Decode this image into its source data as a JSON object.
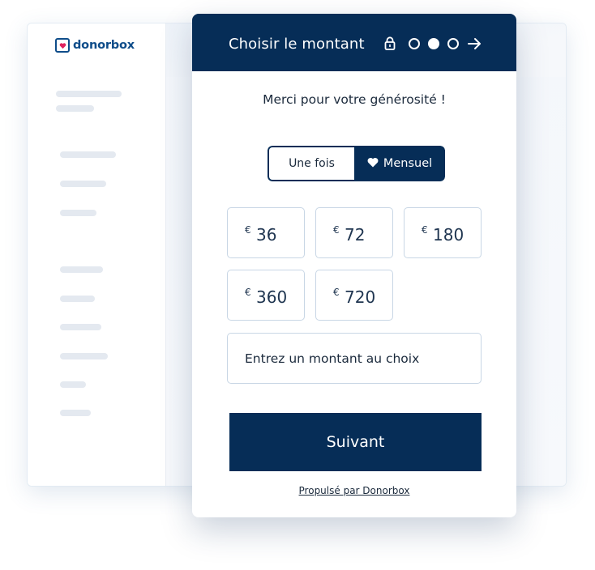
{
  "brand": {
    "logo_text": "donorbox",
    "color": "#0f4d8a"
  },
  "colors": {
    "navy": "#062d57",
    "border": "#c8d6e5",
    "skeleton": "#e4e9f0"
  },
  "widget": {
    "title": "Choisir le montant",
    "icons": [
      "lock-icon",
      "step-dot-empty",
      "step-dot-filled",
      "step-dot-empty",
      "arrow-right-icon"
    ],
    "thanks_text": "Merci pour votre générosité !",
    "frequency": {
      "once_label": "Une fois",
      "monthly_label": "Mensuel",
      "selected": "monthly"
    },
    "currency": "€",
    "amounts": [
      "36",
      "72",
      "180",
      "360",
      "720"
    ],
    "custom_placeholder": "Entrez un montant au choix",
    "next_label": "Suivant",
    "powered_by": "Propulsé par Donorbox"
  }
}
